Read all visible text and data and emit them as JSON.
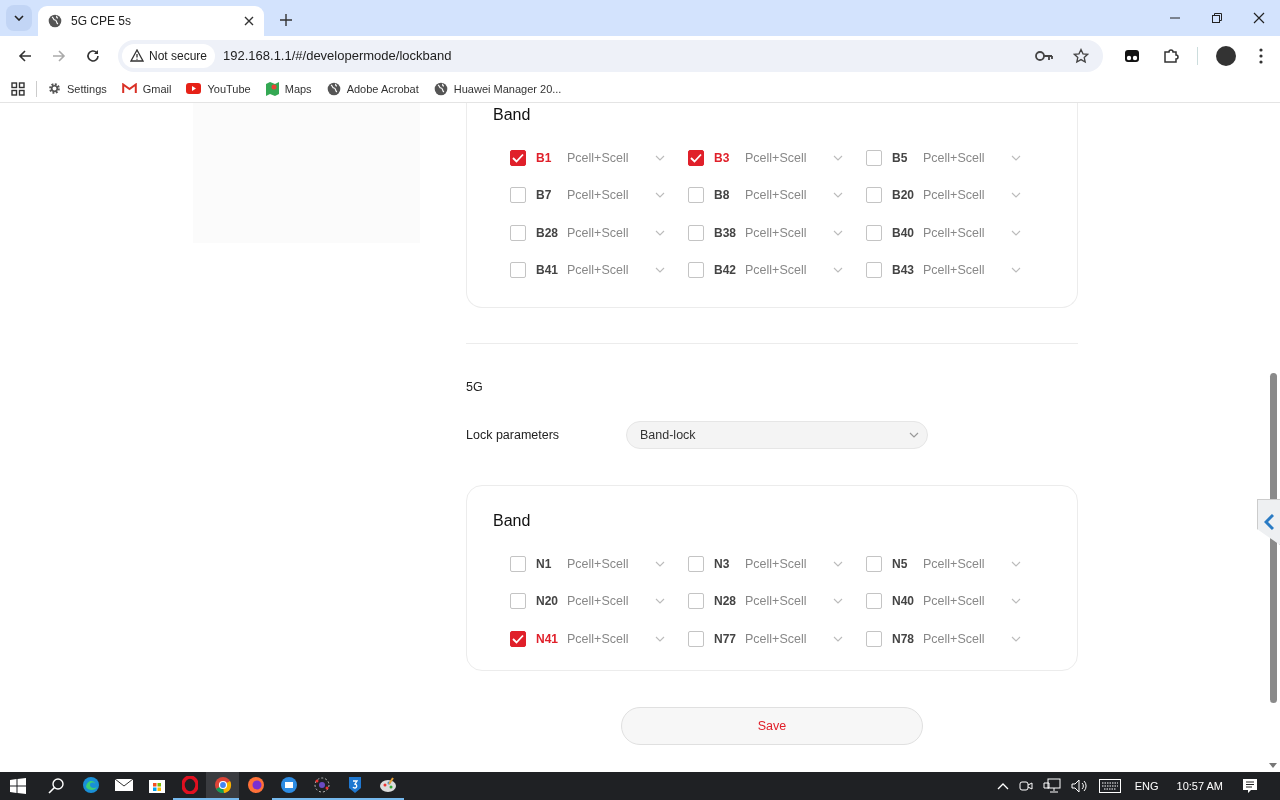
{
  "browser": {
    "tabs": [
      {
        "title": "5G CPE 5s",
        "selected": true
      }
    ],
    "address": {
      "security": "Not secure",
      "url": "192.168.1.1/#/developermode/lockband"
    },
    "bookmarks": [
      {
        "kind": "gear",
        "label": "Settings"
      },
      {
        "kind": "gmail",
        "label": "Gmail"
      },
      {
        "kind": "youtube",
        "label": "YouTube"
      },
      {
        "kind": "maps",
        "label": "Maps"
      },
      {
        "kind": "globe",
        "label": "Adobe Acrobat"
      },
      {
        "kind": "globe",
        "label": "Huawei Manager 20..."
      }
    ]
  },
  "lte": {
    "band_title": "Band",
    "bands": [
      {
        "name": "B1",
        "checked": true,
        "mode": "Pcell+Scell"
      },
      {
        "name": "B3",
        "checked": true,
        "mode": "Pcell+Scell"
      },
      {
        "name": "B5",
        "checked": false,
        "mode": "Pcell+Scell"
      },
      {
        "name": "B7",
        "checked": false,
        "mode": "Pcell+Scell"
      },
      {
        "name": "B8",
        "checked": false,
        "mode": "Pcell+Scell"
      },
      {
        "name": "B20",
        "checked": false,
        "mode": "Pcell+Scell"
      },
      {
        "name": "B28",
        "checked": false,
        "mode": "Pcell+Scell"
      },
      {
        "name": "B38",
        "checked": false,
        "mode": "Pcell+Scell"
      },
      {
        "name": "B40",
        "checked": false,
        "mode": "Pcell+Scell"
      },
      {
        "name": "B41",
        "checked": false,
        "mode": "Pcell+Scell"
      },
      {
        "name": "B42",
        "checked": false,
        "mode": "Pcell+Scell"
      },
      {
        "name": "B43",
        "checked": false,
        "mode": "Pcell+Scell"
      }
    ]
  },
  "nr": {
    "title": "5G",
    "lock_label": "Lock parameters",
    "lock_value": "Band-lock",
    "band_title": "Band",
    "bands": [
      {
        "name": "N1",
        "checked": false,
        "mode": "Pcell+Scell"
      },
      {
        "name": "N3",
        "checked": false,
        "mode": "Pcell+Scell"
      },
      {
        "name": "N5",
        "checked": false,
        "mode": "Pcell+Scell"
      },
      {
        "name": "N20",
        "checked": false,
        "mode": "Pcell+Scell"
      },
      {
        "name": "N28",
        "checked": false,
        "mode": "Pcell+Scell"
      },
      {
        "name": "N40",
        "checked": false,
        "mode": "Pcell+Scell"
      },
      {
        "name": "N41",
        "checked": true,
        "mode": "Pcell+Scell"
      },
      {
        "name": "N77",
        "checked": false,
        "mode": "Pcell+Scell"
      },
      {
        "name": "N78",
        "checked": false,
        "mode": "Pcell+Scell"
      }
    ]
  },
  "save": "Save",
  "taskbar": {
    "apps": [
      {
        "kind": "edge",
        "running": false,
        "selected": false
      },
      {
        "kind": "mail",
        "running": false,
        "selected": false
      },
      {
        "kind": "store",
        "running": false,
        "selected": false
      },
      {
        "kind": "opera",
        "running": true,
        "selected": false
      },
      {
        "kind": "chrome",
        "running": true,
        "selected": true
      },
      {
        "kind": "firefox",
        "running": false,
        "selected": false
      },
      {
        "kind": "blue",
        "running": true,
        "selected": false
      },
      {
        "kind": "molecule",
        "running": true,
        "selected": false
      },
      {
        "kind": "shield",
        "running": true,
        "selected": false
      },
      {
        "kind": "paint",
        "running": true,
        "selected": false
      }
    ],
    "language": "ENG",
    "time": "10:57 AM"
  }
}
